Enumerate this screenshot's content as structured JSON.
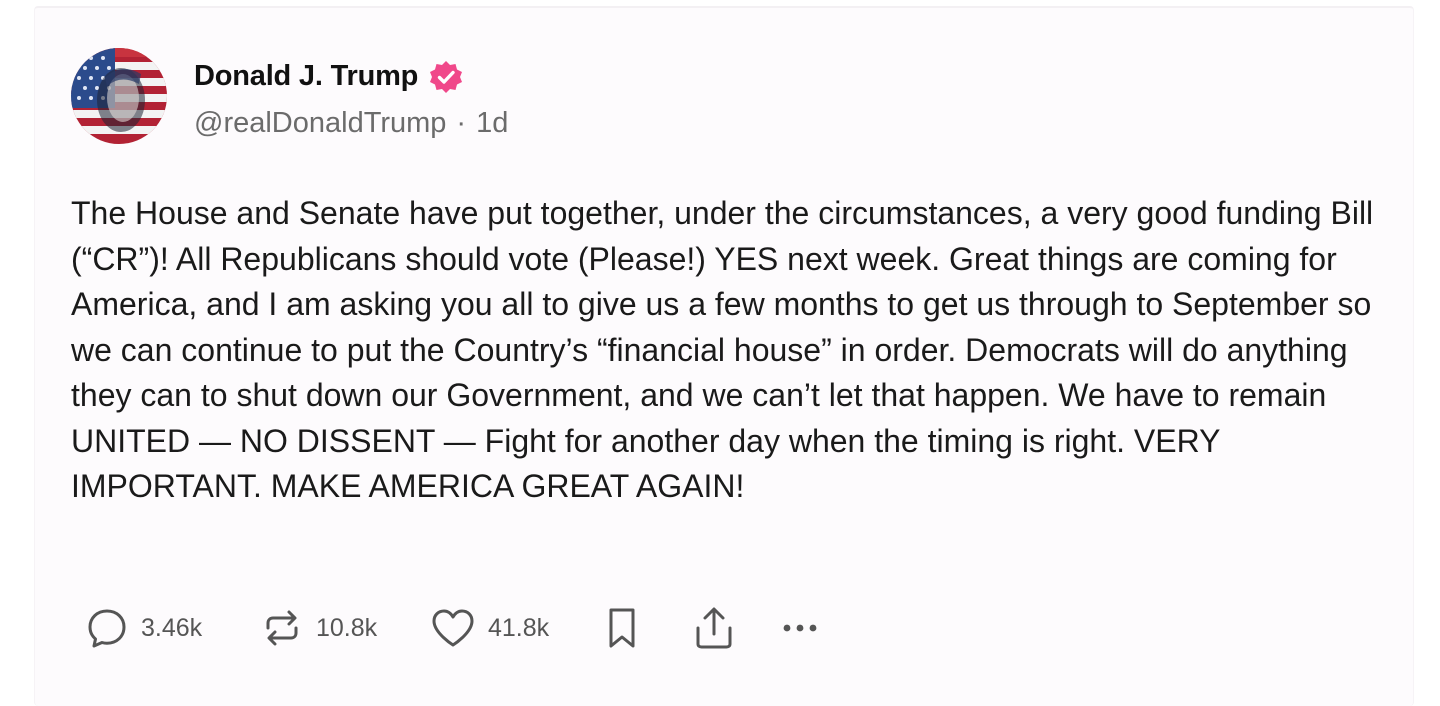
{
  "post": {
    "author": {
      "name": "Donald J. Trump",
      "handle": "@realDonaldTrump",
      "separator": "·",
      "age": "1d",
      "avatar_icon": "avatar-flag-portrait",
      "verified_icon": "verified-badge-icon",
      "verified_color": "#f0488a"
    },
    "text": "The House and Senate have put together, under the circumstances, a very good funding Bill (“CR”)! All Republicans should vote (Please!) YES next week. Great things are coming for America, and I am asking you all to give us a few months to get us through to September so we can continue to put the Country’s “financial house” in order. Democrats will do anything they can to shut down our Government, and we can’t let that happen. We have to remain UNITED — NO DISSENT — Fight for another day when the timing is right. VERY IMPORTANT. MAKE AMERICA GREAT AGAIN!",
    "actions": {
      "replies": "3.46k",
      "reposts": "10.8k",
      "likes": "41.8k",
      "reply_icon": "reply-icon",
      "repost_icon": "repost-icon",
      "like_icon": "heart-icon",
      "bookmark_icon": "bookmark-icon",
      "share_icon": "share-icon",
      "more_icon": "more-icon"
    }
  },
  "colors": {
    "card_background": "#fdfbfd",
    "text": "#1a1a1a",
    "muted": "#6b6b6b",
    "icon": "#555555"
  }
}
